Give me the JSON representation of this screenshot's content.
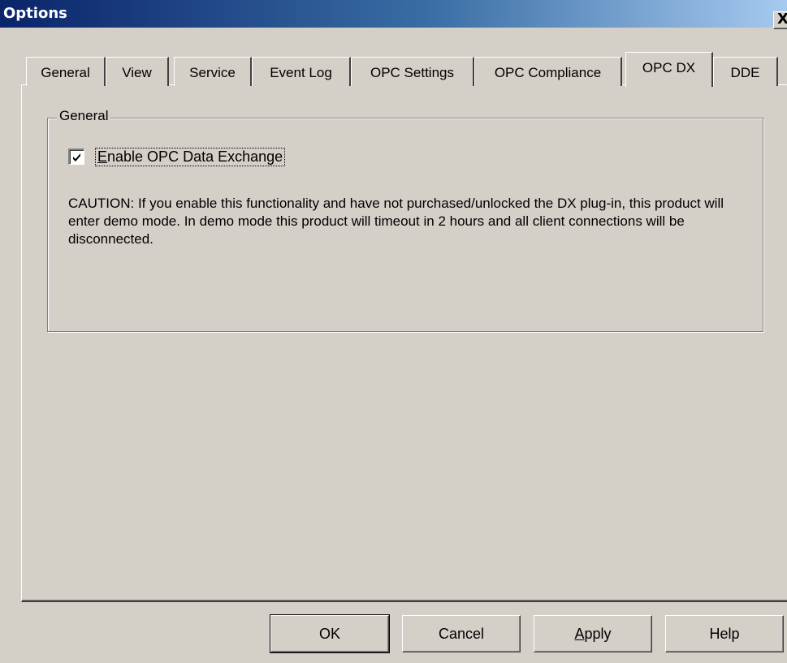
{
  "window": {
    "title": "Options",
    "close_glyph": "X"
  },
  "tabs": [
    {
      "label": "General",
      "active": false
    },
    {
      "label": "View",
      "active": false
    },
    {
      "label": "Service",
      "active": false
    },
    {
      "label": "Event Log",
      "active": false
    },
    {
      "label": "OPC Settings",
      "active": false
    },
    {
      "label": "OPC Compliance",
      "active": false
    },
    {
      "label": "OPC DX",
      "active": true
    },
    {
      "label": "DDE",
      "active": false
    }
  ],
  "group": {
    "title": "General",
    "checkbox": {
      "label_accel": "E",
      "label_rest": "nable OPC Data Exchange",
      "checked": true
    },
    "caution": "CAUTION: If you enable this functionality and have not purchased/unlocked the DX plug-in, this product will enter demo mode. In demo mode this product will timeout in 2 hours and all client connections will be disconnected."
  },
  "buttons": {
    "ok": "OK",
    "cancel": "Cancel",
    "apply_accel": "A",
    "apply_rest": "pply",
    "help": "Help"
  }
}
